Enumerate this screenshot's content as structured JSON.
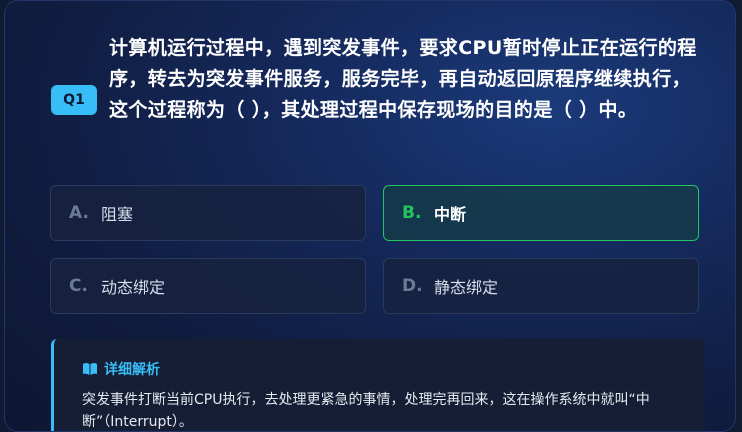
{
  "question": {
    "badge": "Q1",
    "text": "计算机运行过程中，遇到突发事件，要求CPU暂时停止正在运行的程序，转去为突发事件服务，服务完毕，再自动返回原程序继续执行，这个过程称为（ ），其处理过程中保存现场的目的是（ ）中。"
  },
  "options": [
    {
      "letter": "A.",
      "text": "阻塞"
    },
    {
      "letter": "B.",
      "text": "中断",
      "correct": true
    },
    {
      "letter": "C.",
      "text": "动态绑定"
    },
    {
      "letter": "D.",
      "text": "静态绑定"
    }
  ],
  "explanation": {
    "icon": "book-icon",
    "title": "详细解析",
    "body": "突发事件打断当前CPU执行，去处理更紧急的事情，处理完再回来，这在操作系统中就叫“中断”（Interrupt）。"
  },
  "colors": {
    "accent": "#38bdf8",
    "correct": "#22c55e"
  }
}
